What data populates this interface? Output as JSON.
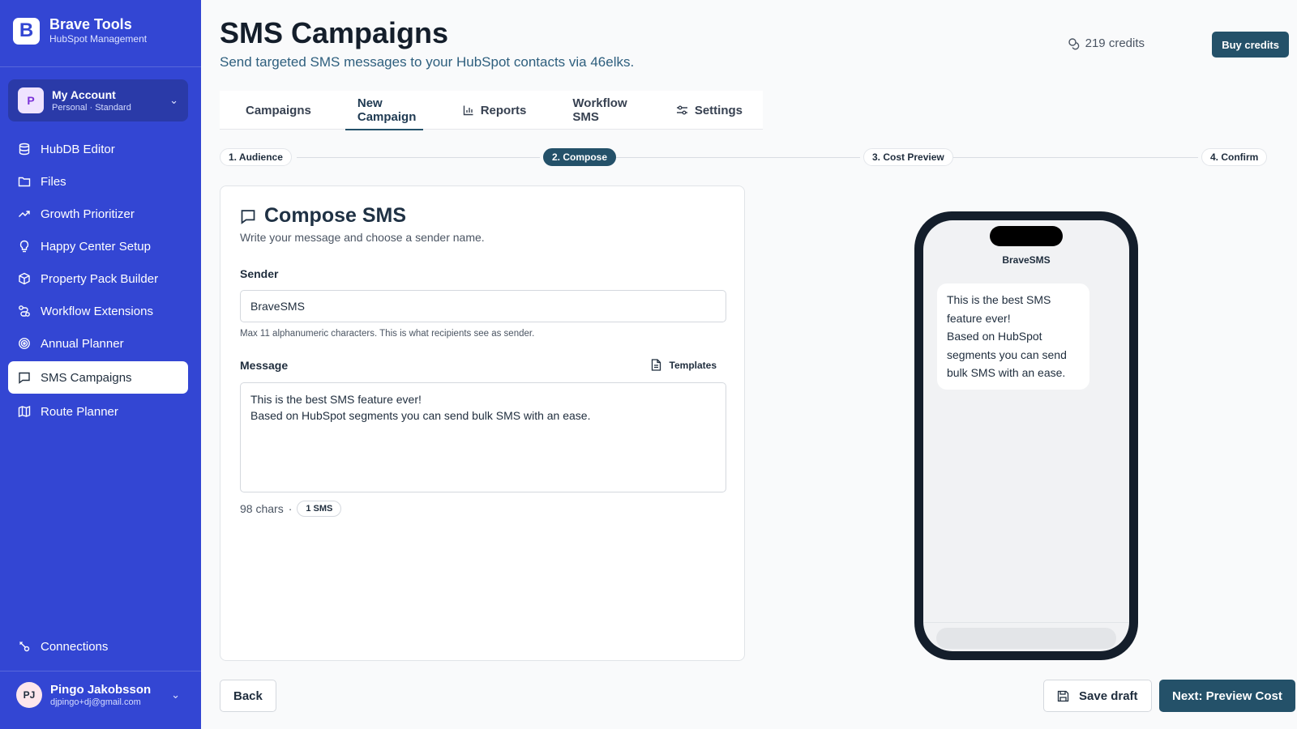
{
  "brand": {
    "name": "Brave Tools",
    "subtitle": "HubSpot Management",
    "logo_letter": "B"
  },
  "account": {
    "initial": "P",
    "name": "My Account",
    "plan": "Personal · Standard"
  },
  "sidebar": {
    "items": [
      {
        "label": "HubDB Editor",
        "icon": "database-icon"
      },
      {
        "label": "Files",
        "icon": "folder-icon"
      },
      {
        "label": "Growth Prioritizer",
        "icon": "trend-icon"
      },
      {
        "label": "Happy Center Setup",
        "icon": "lightbulb-icon"
      },
      {
        "label": "Property Pack Builder",
        "icon": "package-icon"
      },
      {
        "label": "Workflow Extensions",
        "icon": "workflow-icon"
      },
      {
        "label": "Annual Planner",
        "icon": "target-icon"
      },
      {
        "label": "SMS Campaigns",
        "icon": "message-icon",
        "active": true
      },
      {
        "label": "Route Planner",
        "icon": "map-icon"
      }
    ],
    "bottom": {
      "label": "Connections",
      "icon": "connections-icon"
    }
  },
  "user": {
    "initials": "PJ",
    "name": "Pingo Jakobsson",
    "email": "djpingo+dj@gmail.com"
  },
  "header": {
    "title": "SMS Campaigns",
    "subtitle": "Send targeted SMS messages to your HubSpot contacts via 46elks.",
    "credits": "219 credits",
    "buy_label": "Buy credits"
  },
  "tabs": [
    {
      "label": "Campaigns"
    },
    {
      "label": "New Campaign",
      "active": true
    },
    {
      "label": "Reports",
      "icon": "chart-icon"
    },
    {
      "label": "Workflow SMS"
    },
    {
      "label": "Settings",
      "icon": "sliders-icon"
    }
  ],
  "steps": [
    {
      "label": "1. Audience"
    },
    {
      "label": "2. Compose",
      "active": true
    },
    {
      "label": "3. Cost Preview"
    },
    {
      "label": "4. Confirm"
    }
  ],
  "compose": {
    "title": "Compose SMS",
    "subtitle": "Write your message and choose a sender name.",
    "sender_label": "Sender",
    "sender_value": "BraveSMS",
    "sender_hint": "Max 11 alphanumeric characters. This is what recipients see as sender.",
    "message_label": "Message",
    "templates_label": "Templates",
    "message_value": "This is the best SMS feature ever!\nBased on HubSpot segments you can send bulk SMS with an ease.",
    "char_count": "98 chars",
    "dot": "·",
    "sms_count": "1 SMS"
  },
  "preview": {
    "sender": "BraveSMS",
    "bubble": "This is the best SMS\nfeature ever!\nBased on HubSpot\nsegments you can send\nbulk SMS with an ease."
  },
  "footer": {
    "back": "Back",
    "save_draft": "Save draft",
    "next": "Next: Preview Cost"
  },
  "colors": {
    "sidebar": "#3346d3",
    "primary": "#245169",
    "active_bg": "#ffffff"
  }
}
